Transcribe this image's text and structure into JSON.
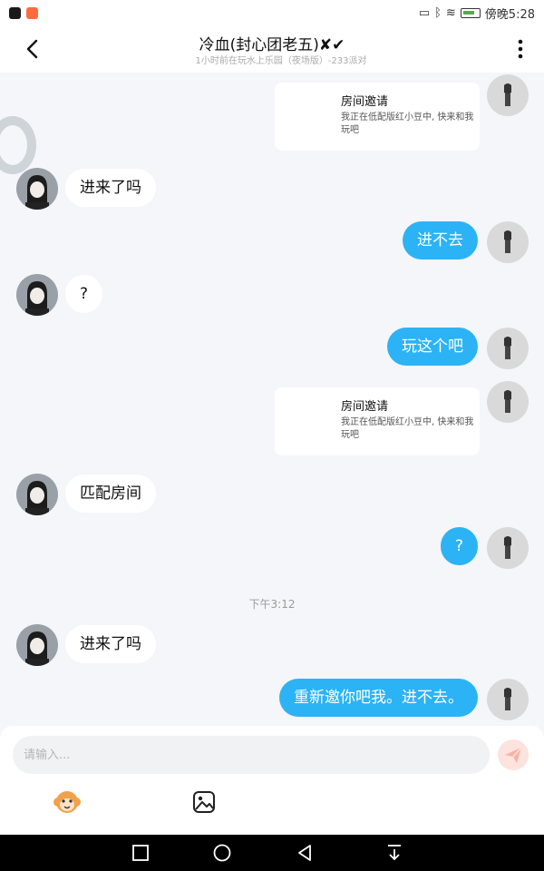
{
  "status_bar": {
    "time": "傍晚5:28",
    "app_icon_colors": [
      "#1a1a1a",
      "#ff6a3d"
    ]
  },
  "header": {
    "title": "冷血(封心团老五)✘✔",
    "subtitle": "1小时前在玩水上乐园（夜场版）-233派对",
    "back_icon": "back-arrow-icon",
    "more_icon": "more-vertical-icon"
  },
  "messages": [
    {
      "type": "invite",
      "side": "right",
      "title": "房间邀请",
      "desc": "我正在低配版红小豆中, 快来和我玩吧"
    },
    {
      "type": "text",
      "side": "left",
      "text": "进来了吗"
    },
    {
      "type": "text",
      "side": "right",
      "text": "进不去"
    },
    {
      "type": "text",
      "side": "left",
      "text": "?"
    },
    {
      "type": "text",
      "side": "right",
      "text": "玩这个吧"
    },
    {
      "type": "invite",
      "side": "right",
      "title": "房间邀请",
      "desc": "我正在低配版红小豆中, 快来和我玩吧"
    },
    {
      "type": "text",
      "side": "left",
      "text": "匹配房间"
    },
    {
      "type": "text",
      "side": "right",
      "text": "?"
    },
    {
      "type": "time",
      "text": "下午3:12"
    },
    {
      "type": "text",
      "side": "left",
      "text": "进来了吗"
    },
    {
      "type": "text",
      "side": "right",
      "text": "重新邀你吧我。进不去。"
    }
  ],
  "input": {
    "placeholder": "请输入...",
    "send_icon": "send-icon",
    "emoji_icon": "monkey-emoji-icon",
    "image_icon": "image-icon"
  },
  "nav_bar": {
    "icons": [
      "recents-square-icon",
      "home-circle-icon",
      "back-triangle-icon",
      "notification-pulldown-icon"
    ]
  },
  "colors": {
    "accent": "#2cb3f5",
    "chat_bg": "#f4f6f9",
    "send_button_bg": "#fce3de"
  }
}
